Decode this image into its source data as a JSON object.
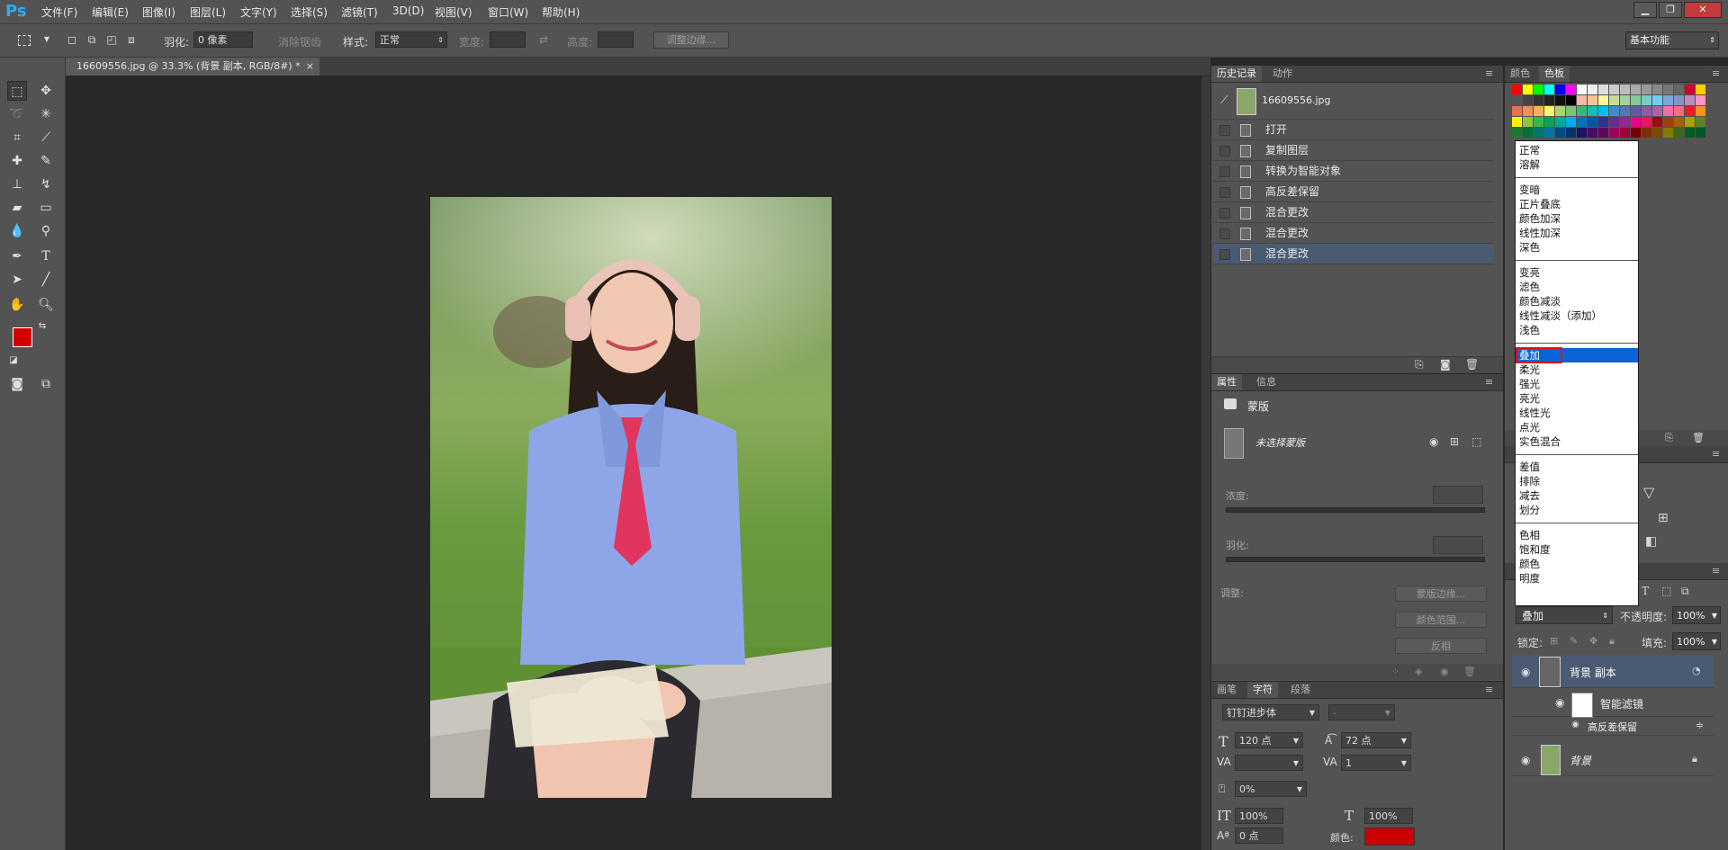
{
  "app": {
    "logo": "Ps"
  },
  "menu": [
    "文件(F)",
    "编辑(E)",
    "图像(I)",
    "图层(L)",
    "文字(Y)",
    "选择(S)",
    "滤镜(T)",
    "3D(D)",
    "视图(V)",
    "窗口(W)",
    "帮助(H)"
  ],
  "window_controls": {
    "minimize": "▁",
    "restore": "❐",
    "close": "✕"
  },
  "options": {
    "feather_label": "羽化:",
    "feather_value": "0 像素",
    "antialias_label": "消除锯齿",
    "style_label": "样式:",
    "style_value": "正常",
    "width_label": "宽度:",
    "height_label": "高度:",
    "refine_edge": "调整边缘...",
    "workspace": "基本功能"
  },
  "document": {
    "tab_title": "16609556.jpg @ 33.3% (背景 副本, RGB/8#) *",
    "tab_close": "×"
  },
  "history": {
    "tabs": [
      "历史记录",
      "动作"
    ],
    "snapshot": "16609556.jpg",
    "items": [
      {
        "label": "打开"
      },
      {
        "label": "复制图层"
      },
      {
        "label": "转换为智能对象"
      },
      {
        "label": "高反差保留"
      },
      {
        "label": "混合更改"
      },
      {
        "label": "混合更改"
      },
      {
        "label": "混合更改"
      }
    ]
  },
  "properties": {
    "tabs": [
      "属性",
      "信息"
    ],
    "mask_title": "蒙版",
    "no_mask": "未选择蒙版",
    "density_label": "浓度:",
    "feather_label": "羽化:",
    "adjust_label": "调整:",
    "buttons": [
      "蒙版边缘...",
      "颜色范围...",
      "反相"
    ]
  },
  "character": {
    "tabs": [
      "画笔",
      "字符",
      "段落"
    ],
    "font_family": "钉钉进步体",
    "font_style": "-",
    "size": "120 点",
    "leading": "72 点",
    "tracking": "1",
    "scale_pct": "0%",
    "vertical_scale": "100%",
    "horizontal_scale": "100%",
    "baseline": "0 点",
    "color_label": "颜色:",
    "color_value": "#cc0000"
  },
  "swatches_panel": {
    "tabs": [
      "颜色",
      "色板"
    ]
  },
  "blend_modes": {
    "groups": [
      [
        "正常",
        "溶解"
      ],
      [
        "变暗",
        "正片叠底",
        "颜色加深",
        "线性加深",
        "深色"
      ],
      [
        "变亮",
        "滤色",
        "颜色减淡",
        "线性减淡（添加）",
        "浅色"
      ],
      [
        "叠加",
        "柔光",
        "强光",
        "亮光",
        "线性光",
        "点光",
        "实色混合"
      ],
      [
        "差值",
        "排除",
        "减去",
        "划分"
      ],
      [
        "色相",
        "饱和度",
        "颜色",
        "明度"
      ]
    ],
    "selected": "叠加"
  },
  "layers": {
    "blend_value": "叠加",
    "opacity_label": "不透明度:",
    "opacity": "100%",
    "lock_label": "锁定:",
    "fill_label": "填充:",
    "fill": "100%",
    "items": [
      {
        "name": "背景 副本"
      },
      {
        "name": "智能滤镜"
      },
      {
        "name": "高反差保留"
      },
      {
        "name": "背景"
      }
    ]
  },
  "colors": {
    "foreground": "#d40000",
    "background": "#f0f0f0",
    "selection": "#0a64d6",
    "highlight_box": "#e01010"
  }
}
